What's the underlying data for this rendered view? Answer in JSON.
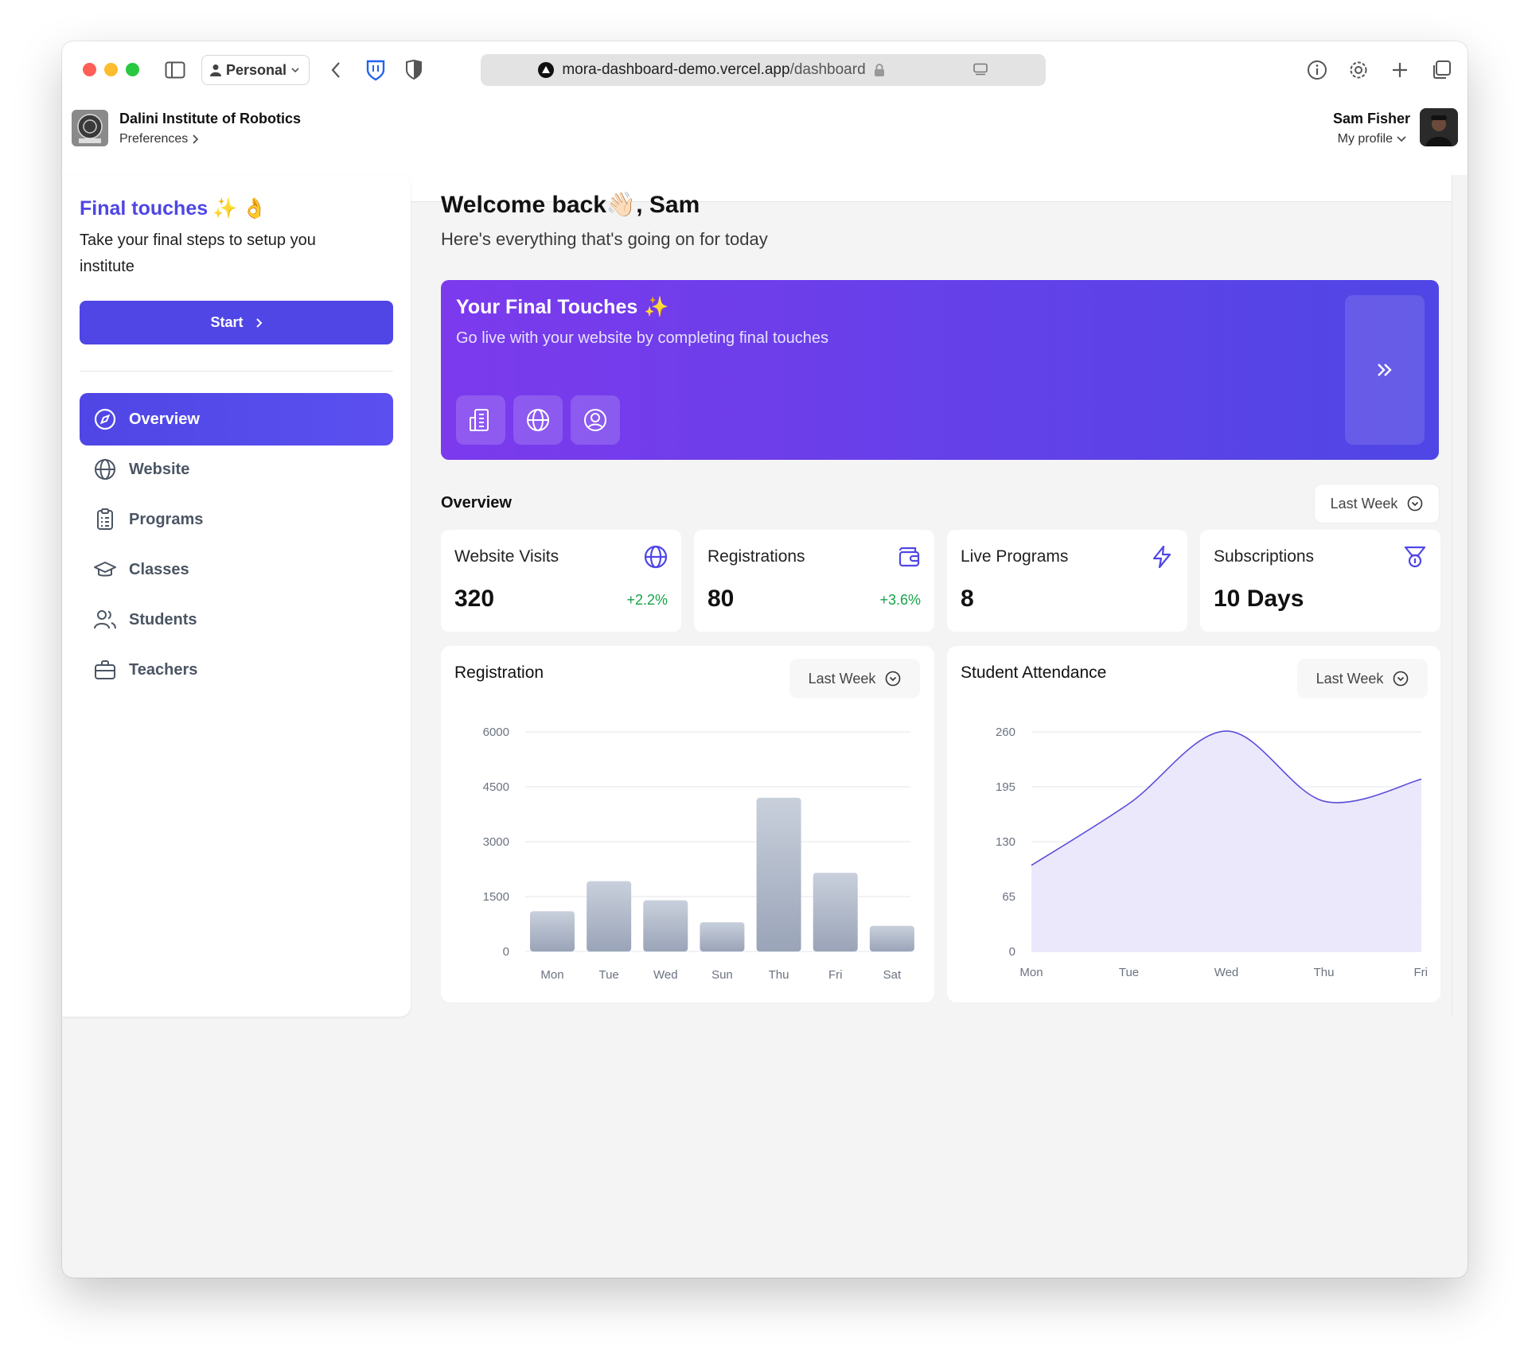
{
  "browser": {
    "profile": "Personal",
    "url_domain": "mora-dashboard-demo.vercel.app",
    "url_path": "/dashboard"
  },
  "header": {
    "org_name": "Dalini Institute of Robotics",
    "org_sub": "Preferences",
    "user_name": "Sam Fisher",
    "user_sub": "My profile"
  },
  "sidebar": {
    "title": "Final touches",
    "description": "Take your final steps to setup you institute",
    "start_label": "Start",
    "items": [
      {
        "label": "Overview",
        "icon": "compass-icon"
      },
      {
        "label": "Website",
        "icon": "globe-icon"
      },
      {
        "label": "Programs",
        "icon": "clipboard-icon"
      },
      {
        "label": "Classes",
        "icon": "graduation-cap-icon"
      },
      {
        "label": "Students",
        "icon": "users-icon"
      },
      {
        "label": "Teachers",
        "icon": "briefcase-icon"
      }
    ]
  },
  "main": {
    "welcome": "Welcome back👋🏻, Sam",
    "subtitle": "Here's everything that's going on for today",
    "banner": {
      "title": "Your Final Touches",
      "subtitle": "Go live with your website by completing final touches"
    },
    "overview_label": "Overview",
    "range_label": "Last Week",
    "stats": [
      {
        "label": "Website Visits",
        "value": "320",
        "delta": "+2.2%",
        "icon": "globe-icon"
      },
      {
        "label": "Registrations",
        "value": "80",
        "delta": "+3.6%",
        "icon": "wallet-icon"
      },
      {
        "label": "Live Programs",
        "value": "8",
        "delta": "",
        "icon": "lightning-icon"
      },
      {
        "label": "Subscriptions",
        "value": "10 Days",
        "delta": "",
        "icon": "medal-icon"
      }
    ]
  },
  "colors": {
    "accent": "#4f46e5",
    "banner_start": "#7c3aed",
    "positive": "#16a34a",
    "area_fill": "#e9e5fc",
    "area_line": "#5b4ed8",
    "bar": "#a7b0c2"
  },
  "chart_data": [
    {
      "type": "bar",
      "title": "Registration",
      "range": "Last Week",
      "categories": [
        "Mon",
        "Tue",
        "Wed",
        "Sun",
        "Thu",
        "Fri",
        "Sat"
      ],
      "values": [
        1100,
        1920,
        1400,
        800,
        4200,
        2150,
        700
      ],
      "yticks": [
        0,
        1500,
        3000,
        4500,
        6000
      ],
      "ylim": [
        0,
        6000
      ],
      "grid": true
    },
    {
      "type": "area",
      "title": "Student Attendance",
      "range": "Last Week",
      "categories": [
        "Mon",
        "Tue",
        "Wed",
        "Thu",
        "Fri"
      ],
      "values": [
        102,
        175,
        261,
        178,
        204
      ],
      "yticks": [
        0,
        65,
        130,
        195,
        260
      ],
      "ylim": [
        0,
        260
      ],
      "grid": true
    }
  ]
}
